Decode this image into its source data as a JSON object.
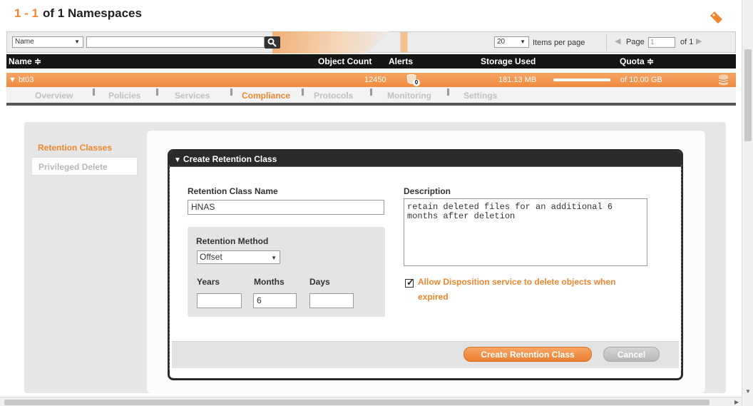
{
  "header": {
    "range": "1 - 1",
    "title": "of 1 Namespaces"
  },
  "filter": {
    "field": "Name",
    "search_value": "",
    "items_per_page": "20",
    "items_per_page_label": "Items per page",
    "page_label": "Page",
    "page_value": "1",
    "of_label": "of 1"
  },
  "table": {
    "columns": {
      "name": "Name ≑",
      "object_count": "Object Count",
      "alerts": "Alerts",
      "storage_used": "Storage Used",
      "quota": "Quota ≑"
    },
    "row": {
      "name": "▼ bt03",
      "object_count": "12450",
      "alerts": "0",
      "storage_used": "181.13 MB",
      "storage_fraction": 0.02,
      "quota": "of 10.00 GB"
    }
  },
  "tabs": [
    "Overview",
    "Policies",
    "Services",
    "Compliance",
    "Protocols",
    "Monitoring",
    "Settings"
  ],
  "active_tab": "Compliance",
  "left_nav": {
    "retention_classes": "Retention Classes",
    "privileged_delete": "Privileged Delete"
  },
  "dialog": {
    "title": "Create Retention Class",
    "name_label": "Retention Class Name",
    "name_value": "HNAS",
    "description_label": "Description",
    "description_value": "retain deleted files for an additional 6\nmonths after deletion",
    "method_label": "Retention Method",
    "method_value": "Offset",
    "years_label": "Years",
    "years_value": "",
    "months_label": "Months",
    "months_value": "6",
    "days_label": "Days",
    "days_value": "",
    "disposition_label_1": "Allow Disposition service to delete objects when",
    "disposition_label_2": "expired",
    "disposition_checked": true,
    "create_button": "Create Retention Class",
    "cancel_button": "Cancel"
  },
  "colors": {
    "accent": "#f0862f",
    "header_dark": "#151515"
  },
  "icons": {
    "tag": "tag-icon",
    "search": "search-icon",
    "alert": "alert-icon",
    "database": "database-icon"
  }
}
